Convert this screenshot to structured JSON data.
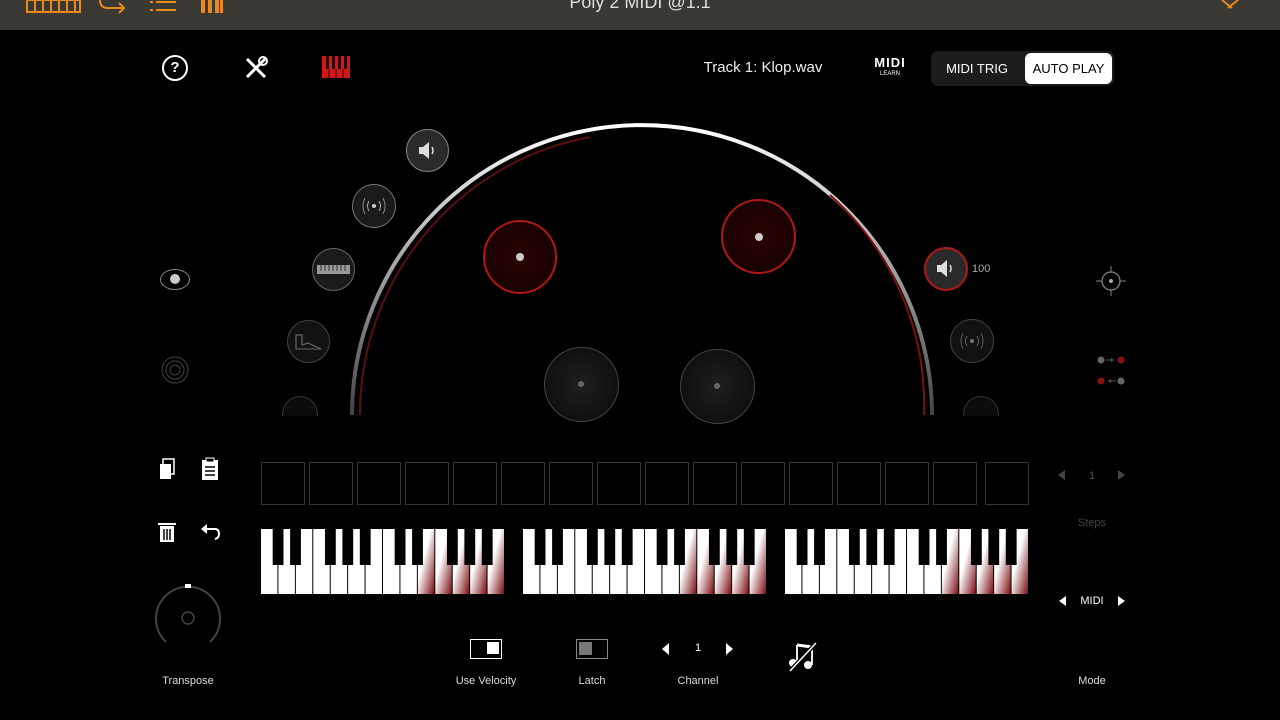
{
  "window": {
    "title": "Poly 2 MIDI @1:1"
  },
  "header": {
    "track": "Track 1: Klop.wav",
    "midi_logo": "MIDI",
    "midi_learn": "LEARN",
    "segment": {
      "options": [
        "MIDI TRIG",
        "AUTO PLAY"
      ],
      "selected": "AUTO PLAY"
    }
  },
  "speaker": {
    "volume": "100"
  },
  "steps": {
    "value": "1",
    "label": "Steps"
  },
  "mode": {
    "value": "MIDI",
    "label": "Mode"
  },
  "controls": {
    "transpose_label": "Transpose",
    "use_velocity_label": "Use Velocity",
    "latch_label": "Latch",
    "channel_label": "Channel",
    "channel_value": "1",
    "use_velocity_on": true,
    "latch_on": false
  },
  "sequencer": {
    "step_count": 16
  },
  "colors": {
    "accent_red": "#d01818",
    "orange": "#e8891c",
    "topbar": "#3a3833"
  }
}
